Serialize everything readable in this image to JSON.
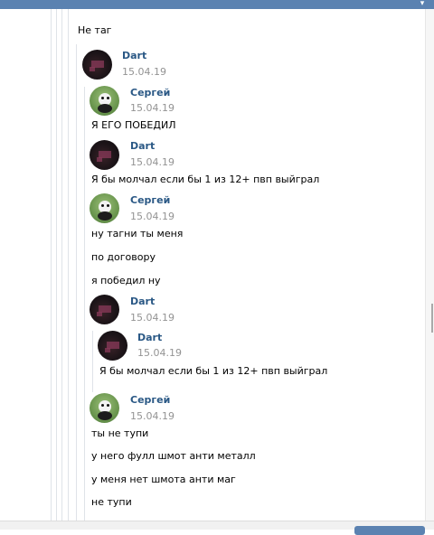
{
  "thread": {
    "top_text": "Не таг",
    "messages": [
      {
        "name": "Dart",
        "date": "15.04.19"
      },
      {
        "name": "Сергей",
        "date": "15.04.19",
        "lines": [
          "Я ЕГО ПОБЕДИЛ"
        ]
      },
      {
        "name": "Dart",
        "date": "15.04.19",
        "lines": [
          "Я бы молчал если бы 1 из 12+ пвп выйграл"
        ]
      },
      {
        "name": "Сергей",
        "date": "15.04.19",
        "lines": [
          "ну тагни ты меня",
          "по договору",
          "я победил ну"
        ]
      },
      {
        "name": "Dart",
        "date": "15.04.19"
      },
      {
        "name": "Dart",
        "date": "15.04.19",
        "lines": [
          "Я бы молчал если бы 1 из 12+ пвп выйграл"
        ]
      },
      {
        "name": "Сергей",
        "date": "15.04.19",
        "lines": [
          "ты не тупи",
          "у него фулл шмот анти металл",
          "у меня нет шмота анти маг",
          "не тупи"
        ]
      }
    ]
  },
  "colors": {
    "accent": "#5b82b1",
    "name": "#2a5885",
    "date": "#939393"
  }
}
